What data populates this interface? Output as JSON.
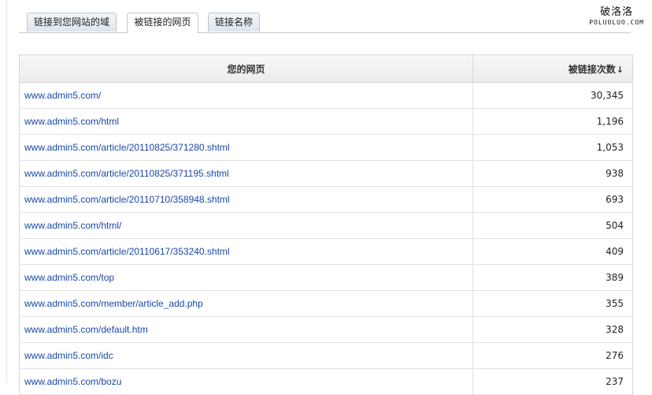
{
  "tabs": [
    {
      "label": "链接到您网站的域"
    },
    {
      "label": "被链接的网页"
    },
    {
      "label": "链接名称"
    }
  ],
  "watermark": {
    "cn": "破洛洛",
    "en": "POLUOLUO.COM"
  },
  "table": {
    "headers": {
      "page": "您的网页",
      "count": "被链接次数",
      "sort_icon": "↓"
    },
    "rows": [
      {
        "url": "www.admin5.com/",
        "count": "30,345"
      },
      {
        "url": "www.admin5.com/html",
        "count": "1,196"
      },
      {
        "url": "www.admin5.com/article/20110825/371280.shtml",
        "count": "1,053"
      },
      {
        "url": "www.admin5.com/article/20110825/371195.shtml",
        "count": "938"
      },
      {
        "url": "www.admin5.com/article/20110710/358948.shtml",
        "count": "693"
      },
      {
        "url": "www.admin5.com/html/",
        "count": "504"
      },
      {
        "url": "www.admin5.com/article/20110617/353240.shtml",
        "count": "409"
      },
      {
        "url": "www.admin5.com/top",
        "count": "389"
      },
      {
        "url": "www.admin5.com/member/article_add.php",
        "count": "355"
      },
      {
        "url": "www.admin5.com/default.htm",
        "count": "328"
      },
      {
        "url": "www.admin5.com/idc",
        "count": "276"
      },
      {
        "url": "www.admin5.com/bozu",
        "count": "237"
      }
    ]
  }
}
